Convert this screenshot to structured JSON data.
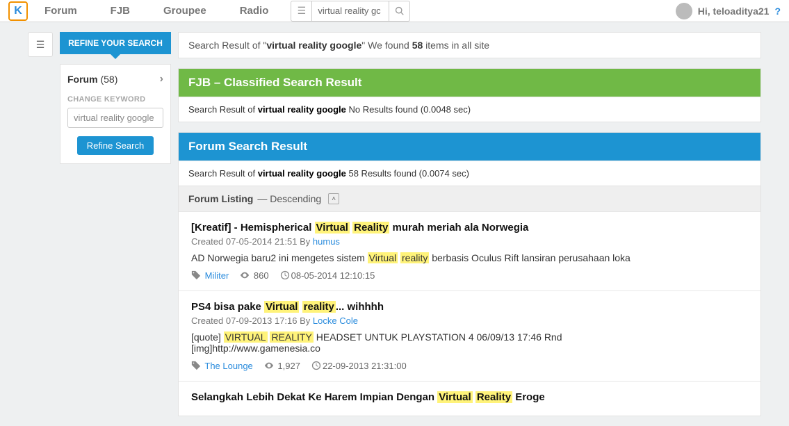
{
  "nav": {
    "items": [
      "Forum",
      "FJB",
      "Groupee",
      "Radio"
    ]
  },
  "topsearch": {
    "value": "virtual reality gc"
  },
  "user": {
    "greeting": "Hi, teloaditya21"
  },
  "sidebar": {
    "refine_header": "REFINE YOUR SEARCH",
    "forum_label": "Forum",
    "forum_count": "(58)",
    "change_label": "CHANGE KEYWORD",
    "keyword_value": "virtual reality google",
    "refine_btn": "Refine Search"
  },
  "top_result": {
    "prefix": "Search Result of \"",
    "query": "virtual reality google",
    "mid": "\" We found ",
    "count": "58",
    "suffix": " items in all site"
  },
  "fjb": {
    "header": "FJB – Classified Search Result",
    "line_prefix": "Search Result of ",
    "query": "virtual reality google",
    "line_suffix": "  No Results found (0.0048 sec)"
  },
  "forum": {
    "header": "Forum Search Result",
    "line_prefix": "Search Result of ",
    "query": "virtual reality google",
    "line_suffix": " 58 Results found (0.0074 sec)",
    "listing_label": "Forum Listing",
    "listing_order": " — Descending"
  },
  "items": [
    {
      "title_parts": [
        "[Kreatif] - Hemispherical ",
        "Virtual",
        " ",
        "Reality",
        " murah meriah ala Norwegia"
      ],
      "hl": [
        false,
        true,
        false,
        true,
        false
      ],
      "created_prefix": "Created ",
      "created": "07-05-2014 21:51",
      "by": " By ",
      "author": "humus",
      "snippet_parts": [
        "AD Norwegia baru2 ini mengetes sistem ",
        "Virtual",
        " ",
        "reality",
        " berbasis Oculus Rift lansiran perusahaan loka"
      ],
      "shl": [
        false,
        true,
        false,
        true,
        false
      ],
      "category": "Militer",
      "views": "860",
      "date2": "08-05-2014 12:10:15"
    },
    {
      "title_parts": [
        "PS4 bisa pake ",
        "Virtual",
        " ",
        "reality",
        "... wihhhh"
      ],
      "hl": [
        false,
        true,
        false,
        true,
        false
      ],
      "created_prefix": "Created ",
      "created": "07-09-2013 17:16",
      "by": " By ",
      "author": "Locke Cole",
      "snippet_parts": [
        "[quote] ",
        "VIRTUAL",
        " ",
        "REALITY",
        " HEADSET UNTUK PLAYSTATION 4 06/09/13 17:46 Rnd [img]http://www.gamenesia.co"
      ],
      "shl": [
        false,
        true,
        false,
        true,
        false
      ],
      "category": "The Lounge",
      "views": "1,927",
      "date2": "22-09-2013 21:31:00"
    },
    {
      "title_parts": [
        "Selangkah Lebih Dekat Ke Harem Impian Dengan ",
        "Virtual",
        " ",
        "Reality",
        " Eroge"
      ],
      "hl": [
        false,
        true,
        false,
        true,
        false
      ]
    }
  ]
}
